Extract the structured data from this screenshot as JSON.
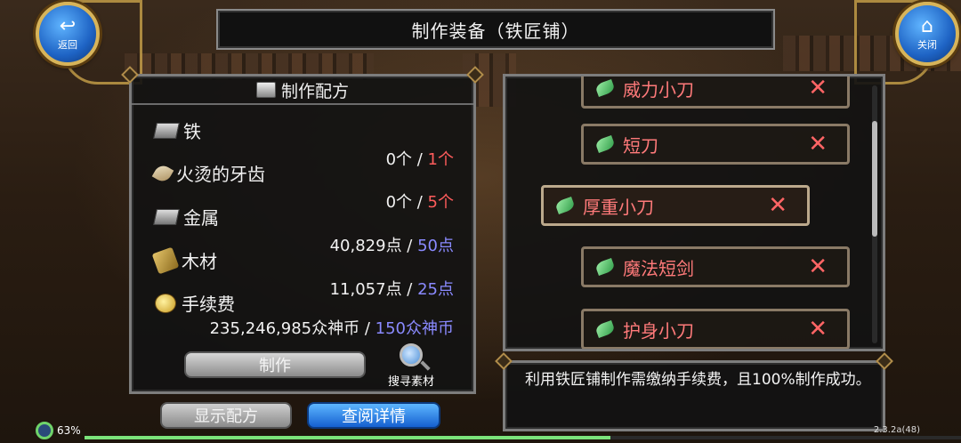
{
  "header": {
    "title": "制作装备（铁匠铺）"
  },
  "nav": {
    "back_label": "返回",
    "close_label": "关闭"
  },
  "recipe": {
    "heading": "制作配方",
    "ingredients": [
      {
        "name": "铁",
        "icon": "ingot-icon",
        "have": "0个",
        "sep": " / ",
        "need": "1个",
        "need_color": "#ff5c5c"
      },
      {
        "name": "火烫的牙齿",
        "icon": "tooth-icon",
        "have": "0个",
        "sep": " / ",
        "need": "5个",
        "need_color": "#ff5c5c"
      },
      {
        "name": "金属",
        "icon": "ingot-icon",
        "have": "40,829点",
        "sep": " / ",
        "need": "50点",
        "need_color": "#8a8aff"
      },
      {
        "name": "木材",
        "icon": "wood-icon",
        "have": "11,057点",
        "sep": " / ",
        "need": "25点",
        "need_color": "#8a8aff"
      },
      {
        "name": "手续费",
        "icon": "coins-icon",
        "have": "235,246,985众神币",
        "sep": " / ",
        "need": "150众神币",
        "need_color": "#8a8aff"
      }
    ],
    "make_label": "制作",
    "search_label": "搜寻素材"
  },
  "buttons": {
    "show_recipe": "显示配方",
    "view_details": "查阅详情"
  },
  "equipment_list": [
    {
      "name": "威力小刀",
      "selected": false
    },
    {
      "name": "短刀",
      "selected": false
    },
    {
      "name": "厚重小刀",
      "selected": true
    },
    {
      "name": "魔法短剑",
      "selected": false
    },
    {
      "name": "护身小刀",
      "selected": false
    }
  ],
  "info": {
    "text": "利用铁匠铺制作需缴纳手续费，且100%制作成功。"
  },
  "status": {
    "battery": "63%",
    "version": "2.3.2a(48)",
    "progress": 0.6
  },
  "colors": {
    "accent_blue": "#1e63c4",
    "gold": "#d7b45a",
    "fail_red": "#ff6565"
  },
  "icons": {
    "close_mark": "✕",
    "back_glyph": "↩",
    "home_glyph": "⌂"
  }
}
